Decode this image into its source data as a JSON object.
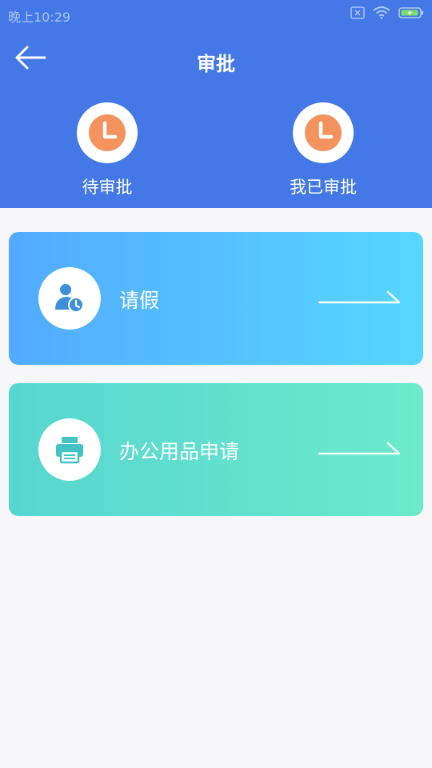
{
  "status_bar": {
    "time": "晚上10:29",
    "icons": [
      "sim-blocked-icon",
      "wifi-icon",
      "battery-charging-icon"
    ]
  },
  "header": {
    "back_icon": "back-arrow-icon",
    "title": "审批",
    "tabs": [
      {
        "label": "待审批",
        "icon": "clock-icon"
      },
      {
        "label": "我已审批",
        "icon": "clock-icon"
      }
    ]
  },
  "cards": [
    {
      "label": "请假",
      "icon": "user-clock-icon",
      "arrow_icon": "long-arrow-right-icon"
    },
    {
      "label": "办公用品申请",
      "icon": "printer-icon",
      "arrow_icon": "long-arrow-right-icon"
    }
  ],
  "colors": {
    "header_bg": "#4378e6",
    "page_bg": "#f7f7f9",
    "clock_accent": "#f4935d",
    "card_leave_start": "#53aaff",
    "card_leave_end": "#56d7ff",
    "card_supply_start": "#56d6d0",
    "card_supply_end": "#6ceacb"
  }
}
